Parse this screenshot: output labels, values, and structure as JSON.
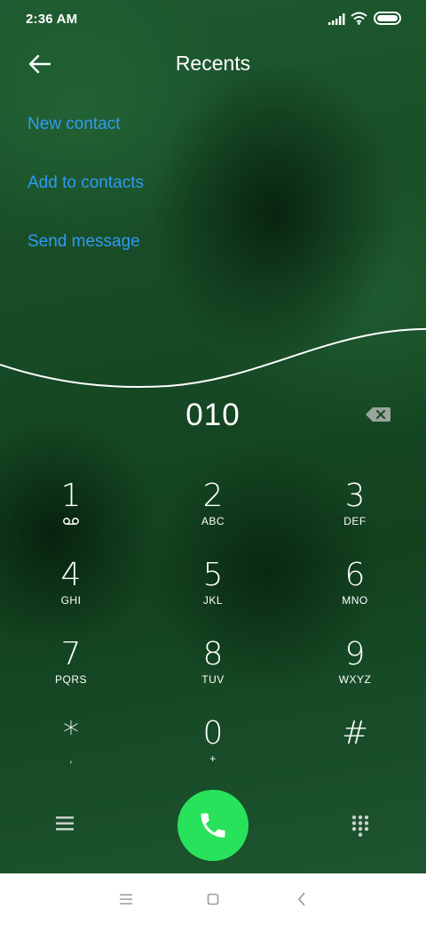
{
  "status_bar": {
    "time": "2:36 AM",
    "icons": [
      "signal-icon",
      "wifi-icon",
      "battery-icon"
    ]
  },
  "header": {
    "title": "Recents",
    "back_icon": "arrow-left-icon"
  },
  "actions": [
    {
      "label": "New contact"
    },
    {
      "label": "Add to contacts"
    },
    {
      "label": "Send message"
    }
  ],
  "dialer": {
    "number": "010",
    "backspace_icon": "backspace-icon"
  },
  "keypad": [
    {
      "digit": "1",
      "letters": ""
    },
    {
      "digit": "2",
      "letters": "ABC"
    },
    {
      "digit": "3",
      "letters": "DEF"
    },
    {
      "digit": "4",
      "letters": "GHI"
    },
    {
      "digit": "5",
      "letters": "JKL"
    },
    {
      "digit": "6",
      "letters": "MNO"
    },
    {
      "digit": "7",
      "letters": "PQRS"
    },
    {
      "digit": "8",
      "letters": "TUV"
    },
    {
      "digit": "9",
      "letters": "WXYZ"
    },
    {
      "digit": "*",
      "letters": ","
    },
    {
      "digit": "0",
      "letters": "+"
    },
    {
      "digit": "#",
      "letters": ""
    }
  ],
  "bottom_bar": {
    "icons": [
      "menu-icon",
      "phone-icon",
      "dialpad-icon"
    ]
  },
  "nav_bar": {
    "icons": [
      "recents-icon",
      "home-icon",
      "back-icon"
    ]
  },
  "colors": {
    "accent_link": "#2f9bf4",
    "call_button": "#28e25b",
    "background": "#174a26"
  }
}
